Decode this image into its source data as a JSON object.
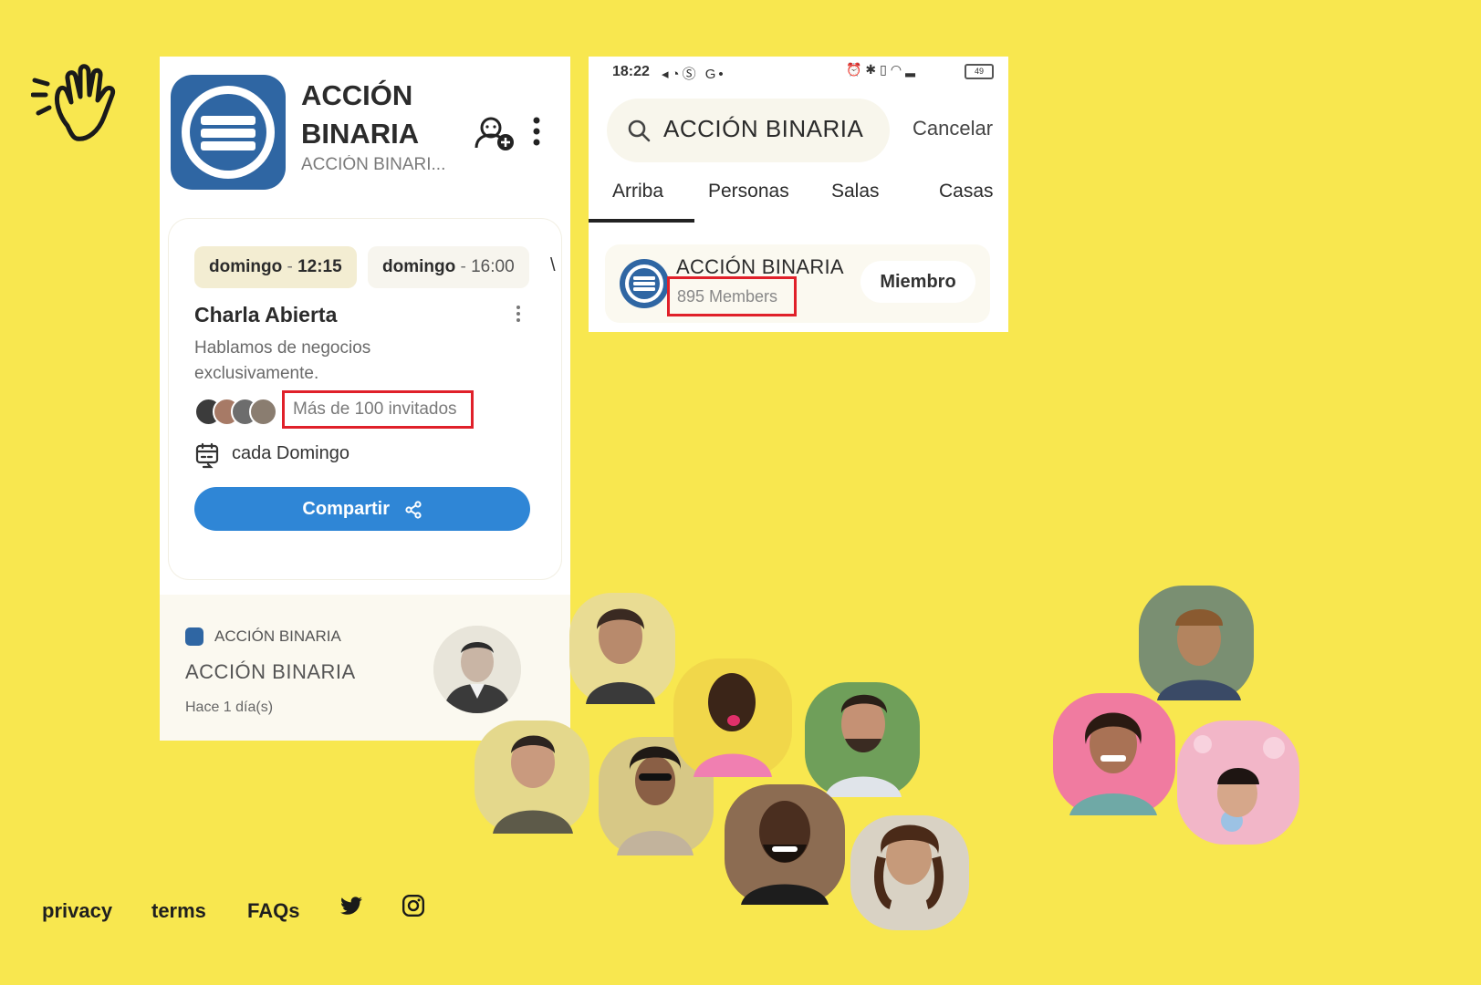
{
  "colors": {
    "background": "#f8e74f",
    "brand_blue": "#2f66a3",
    "share_blue": "#2f86d6",
    "highlight_red": "#e0202a"
  },
  "club": {
    "name": "ACCIÓN BINARIA",
    "subtitle": "ACCIÓN BINARI..."
  },
  "event": {
    "schedule_chips": [
      {
        "day": "domingo",
        "sep": " - ",
        "time": "12:15"
      },
      {
        "day": "domingo",
        "sep": " - ",
        "time": "16:00"
      }
    ],
    "chip_overflow": "\\",
    "title": "Charla Abierta",
    "description": "Hablamos de negocios exclusivamente.",
    "guests": "Más de 100 invitados",
    "recurrence": "cada Domingo",
    "share_label": "Compartir"
  },
  "feed": {
    "club": "ACCIÓN BINARIA",
    "title": "ACCIÓN BINARIA",
    "time": "Hace 1 día(s)"
  },
  "search_screen": {
    "status_time": "18:22",
    "battery": "49",
    "search_value": "ACCIÓN BINARIA",
    "cancel_label": "Cancelar",
    "tabs": [
      "Arriba",
      "Personas",
      "Salas",
      "Casas"
    ],
    "active_tab": "Arriba",
    "result": {
      "name": "ACCIÓN BINARIA",
      "members": "895 Members",
      "action_label": "Miembro"
    }
  },
  "footer": {
    "links": [
      "privacy",
      "terms",
      "FAQs"
    ],
    "icons": [
      "twitter-icon",
      "instagram-icon"
    ]
  }
}
